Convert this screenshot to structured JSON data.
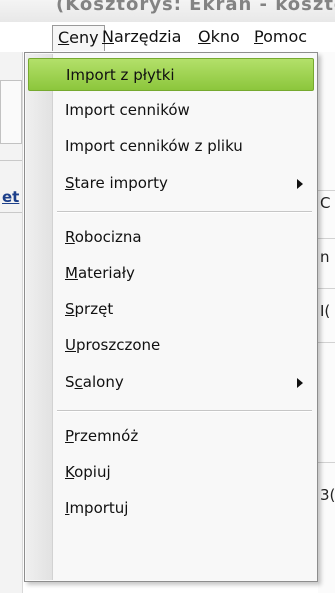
{
  "window": {
    "title_fragment": "(Kosztorys: Ekran - kosztorys)"
  },
  "menubar": {
    "items": [
      {
        "label": "Ceny",
        "accel_index": 0
      },
      {
        "label": "Narzędzia",
        "accel_index": 0
      },
      {
        "label": "Okno",
        "accel_index": 0
      },
      {
        "label": "Pomoc",
        "accel_index": 0
      }
    ],
    "open_menu": "Ceny"
  },
  "left_panel": {
    "tab_label_fragment": "et"
  },
  "right_panel": {
    "text_fragments": [
      "C",
      "n",
      "I(",
      "3("
    ]
  },
  "dropdown": {
    "items": [
      {
        "label": "Import z płytki",
        "accel": "",
        "highlighted": true,
        "submenu": false
      },
      {
        "label": "Import cenników",
        "accel": "",
        "highlighted": false,
        "submenu": false
      },
      {
        "label": "Import cenników z pliku",
        "accel": "",
        "highlighted": false,
        "submenu": false
      },
      {
        "label": "Stare importy",
        "accel": "S",
        "highlighted": false,
        "submenu": true
      },
      {
        "separator": true
      },
      {
        "label": "Robocizna",
        "accel": "R",
        "highlighted": false,
        "submenu": false
      },
      {
        "label": "Materiały",
        "accel": "M",
        "highlighted": false,
        "submenu": false
      },
      {
        "label": "Sprzęt",
        "accel": "S",
        "highlighted": false,
        "submenu": false
      },
      {
        "label": "Uproszczone",
        "accel": "U",
        "highlighted": false,
        "submenu": false
      },
      {
        "label": "Scalony",
        "accel": "c",
        "highlighted": false,
        "submenu": true
      },
      {
        "separator": true
      },
      {
        "label": "Przemnóż",
        "accel": "P",
        "highlighted": false,
        "submenu": false
      },
      {
        "label": "Kopiuj",
        "accel": "K",
        "highlighted": false,
        "submenu": false
      },
      {
        "label": "Importuj",
        "accel": "I",
        "highlighted": false,
        "submenu": false
      }
    ]
  },
  "colors": {
    "highlight_top": "#b3e06a",
    "highlight_bottom": "#8cc63c",
    "highlight_border": "#76a92f",
    "menu_background": "#f8f8f8",
    "menu_border": "#8d8d8d"
  }
}
